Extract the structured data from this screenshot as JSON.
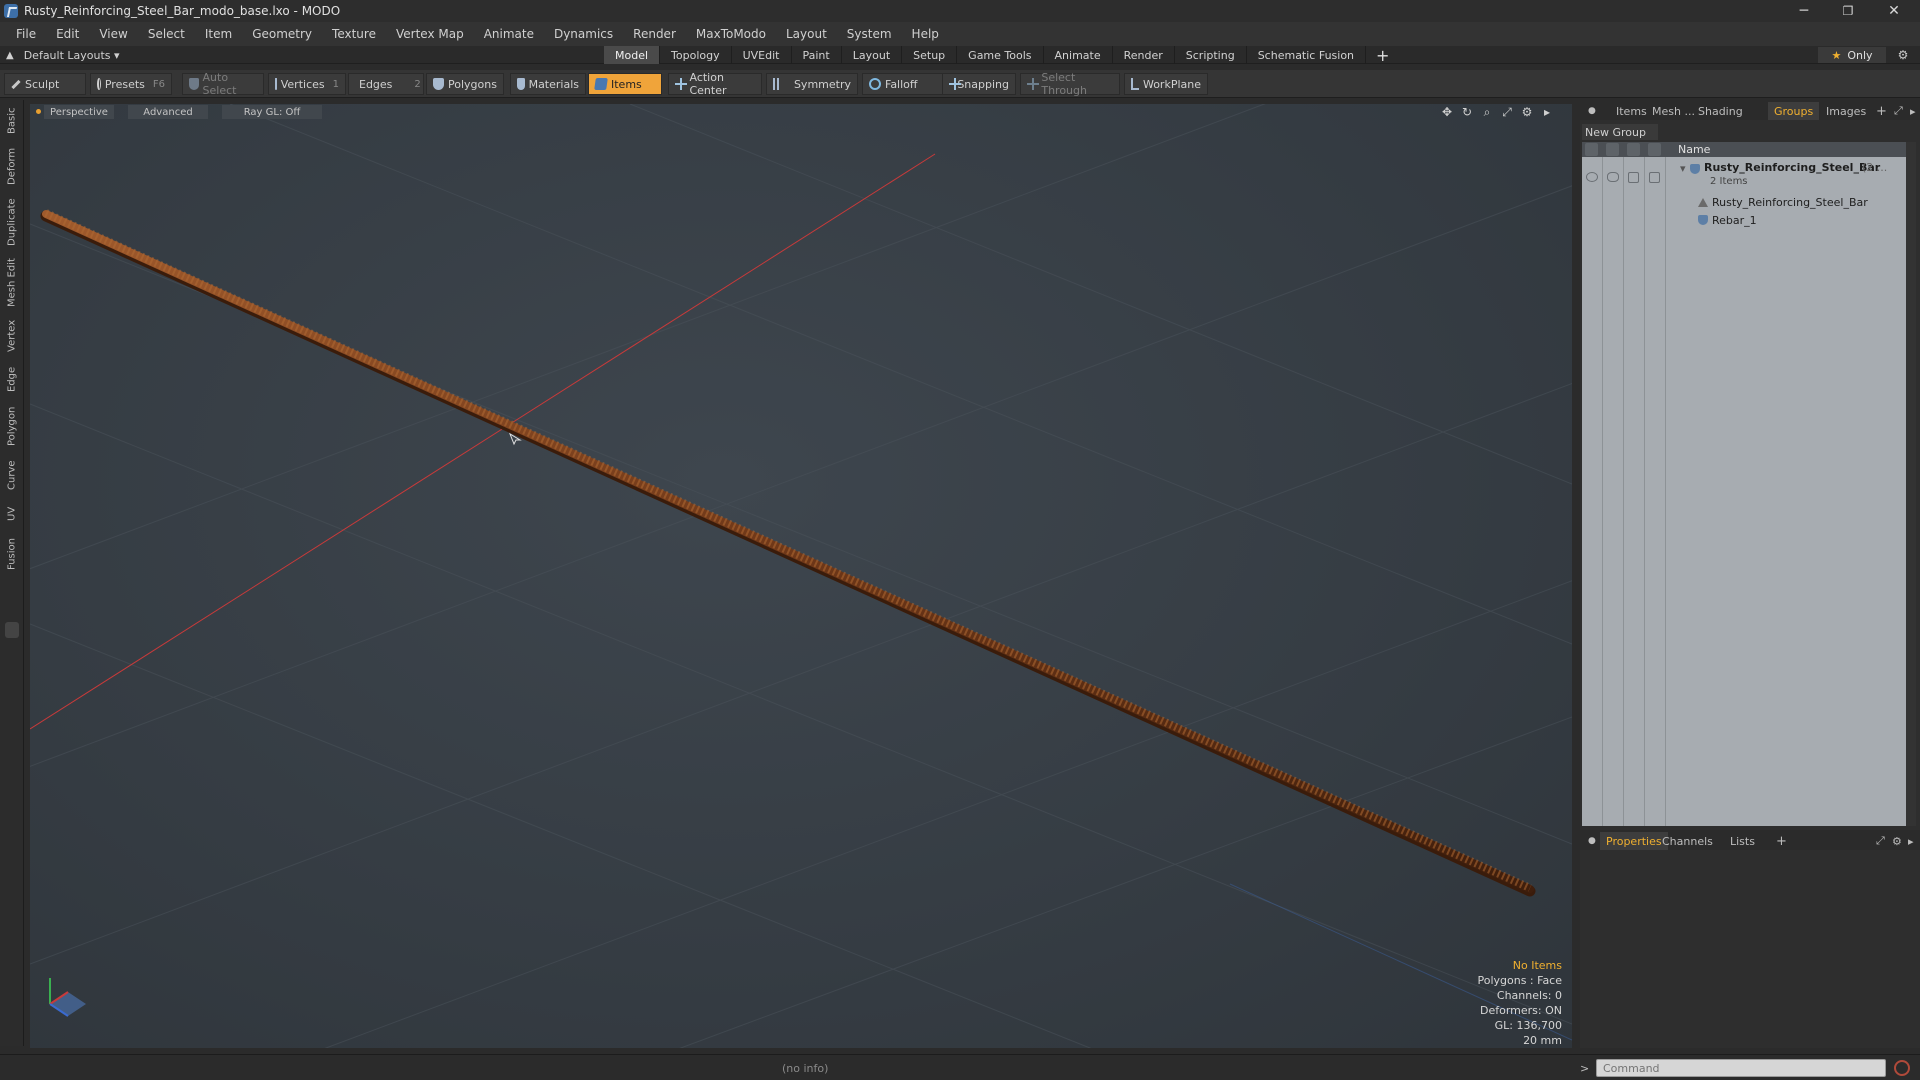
{
  "window": {
    "title": "Rusty_Reinforcing_Steel_Bar_modo_base.lxo - MODO",
    "minimize": "─",
    "maximize": "❐",
    "close": "✕"
  },
  "menu": [
    "File",
    "Edit",
    "View",
    "Select",
    "Item",
    "Geometry",
    "Texture",
    "Vertex Map",
    "Animate",
    "Dynamics",
    "Render",
    "MaxToModo",
    "Layout",
    "System",
    "Help"
  ],
  "layouts": {
    "label": "Default Layouts ▾"
  },
  "mode_tabs": [
    "Model",
    "Topology",
    "UVEdit",
    "Paint",
    "Layout",
    "Setup",
    "Game Tools",
    "Animate",
    "Render",
    "Scripting",
    "Schematic Fusion"
  ],
  "mode_add": "+",
  "only": {
    "star": "★",
    "label": "Only"
  },
  "toolbar": {
    "sculpt": "Sculpt",
    "presets": "Presets",
    "presets_key": "F6",
    "auto_select": "Auto Select",
    "vertices": "Vertices",
    "vertices_key": "1",
    "edges": "Edges",
    "edges_key": "2",
    "polygons": "Polygons",
    "materials": "Materials",
    "items": "Items",
    "action_center": "Action Center",
    "symmetry": "Symmetry",
    "falloff": "Falloff",
    "snapping": "Snapping",
    "select_through": "Select Through",
    "workplane": "WorkPlane"
  },
  "left_tabs": [
    "Basic",
    "Deform",
    "Duplicate",
    "Mesh Edit",
    "Vertex",
    "Edge",
    "Polygon",
    "Curve",
    "UV",
    "Fusion"
  ],
  "viewport": {
    "perspective": "Perspective",
    "advanced": "Advanced",
    "raygl": "Ray GL: Off",
    "info": {
      "no_items": "No Items",
      "polygons": "Polygons : Face",
      "channels": "Channels: 0",
      "deformers": "Deformers: ON",
      "gl": "GL: 136,700",
      "scale": "20 mm"
    }
  },
  "right_tabs": [
    "Items",
    "Mesh ...",
    "Shading",
    "Groups",
    "Images"
  ],
  "right_tab_add": "+",
  "groups": {
    "new_group": "New Group",
    "column_name": "Name",
    "root": "Rusty_Reinforcing_Steel_Bar",
    "root_suffix": "(2 ...",
    "count": "2 Items",
    "children": [
      "Rusty_Reinforcing_Steel_Bar",
      "Rebar_1"
    ]
  },
  "bottom_tabs": [
    "Properties",
    "Channels",
    "Lists"
  ],
  "bottom_tab_add": "+",
  "status": {
    "info": "(no info)",
    "prompt": ">",
    "command_placeholder": "Command"
  },
  "colors": {
    "accent": "#f0a43a",
    "rebar": "#7a3f1e",
    "x_axis": "#c83a3a"
  }
}
